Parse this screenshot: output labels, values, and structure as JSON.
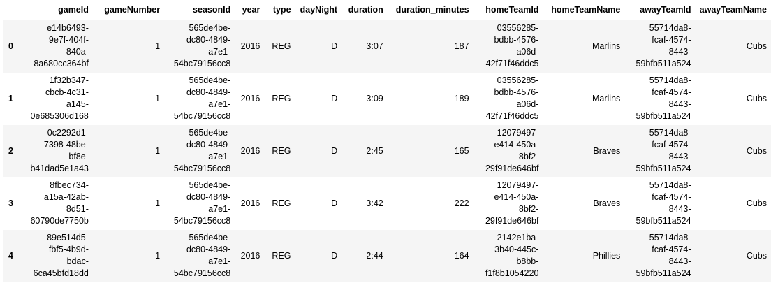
{
  "table": {
    "columns": [
      "gameId",
      "gameNumber",
      "seasonId",
      "year",
      "type",
      "dayNight",
      "duration",
      "duration_minutes",
      "homeTeamId",
      "homeTeamName",
      "awayTeamId",
      "awayTeamName"
    ],
    "rows": [
      {
        "index": "0",
        "cells": [
          [
            "e14b6493-",
            "9e7f-404f-",
            "840a-",
            "8a680cc364bf"
          ],
          [
            "1"
          ],
          [
            "565de4be-",
            "dc80-4849-",
            "a7e1-",
            "54bc79156cc8"
          ],
          [
            "2016"
          ],
          [
            "REG"
          ],
          [
            "D"
          ],
          [
            "3:07"
          ],
          [
            "187"
          ],
          [
            "03556285-",
            "bdbb-4576-",
            "a06d-",
            "42f71f46ddc5"
          ],
          [
            "Marlins"
          ],
          [
            "55714da8-",
            "fcaf-4574-",
            "8443-",
            "59bfb511a524"
          ],
          [
            "Cubs"
          ]
        ]
      },
      {
        "index": "1",
        "cells": [
          [
            "1f32b347-",
            "cbcb-4c31-",
            "a145-",
            "0e685306d168"
          ],
          [
            "1"
          ],
          [
            "565de4be-",
            "dc80-4849-",
            "a7e1-",
            "54bc79156cc8"
          ],
          [
            "2016"
          ],
          [
            "REG"
          ],
          [
            "D"
          ],
          [
            "3:09"
          ],
          [
            "189"
          ],
          [
            "03556285-",
            "bdbb-4576-",
            "a06d-",
            "42f71f46ddc5"
          ],
          [
            "Marlins"
          ],
          [
            "55714da8-",
            "fcaf-4574-",
            "8443-",
            "59bfb511a524"
          ],
          [
            "Cubs"
          ]
        ]
      },
      {
        "index": "2",
        "cells": [
          [
            "0c2292d1-",
            "7398-48be-",
            "bf8e-",
            "b41dad5e1a43"
          ],
          [
            "1"
          ],
          [
            "565de4be-",
            "dc80-4849-",
            "a7e1-",
            "54bc79156cc8"
          ],
          [
            "2016"
          ],
          [
            "REG"
          ],
          [
            "D"
          ],
          [
            "2:45"
          ],
          [
            "165"
          ],
          [
            "12079497-",
            "e414-450a-",
            "8bf2-",
            "29f91de646bf"
          ],
          [
            "Braves"
          ],
          [
            "55714da8-",
            "fcaf-4574-",
            "8443-",
            "59bfb511a524"
          ],
          [
            "Cubs"
          ]
        ]
      },
      {
        "index": "3",
        "cells": [
          [
            "8fbec734-",
            "a15a-42ab-",
            "8d51-",
            "60790de7750b"
          ],
          [
            "1"
          ],
          [
            "565de4be-",
            "dc80-4849-",
            "a7e1-",
            "54bc79156cc8"
          ],
          [
            "2016"
          ],
          [
            "REG"
          ],
          [
            "D"
          ],
          [
            "3:42"
          ],
          [
            "222"
          ],
          [
            "12079497-",
            "e414-450a-",
            "8bf2-",
            "29f91de646bf"
          ],
          [
            "Braves"
          ],
          [
            "55714da8-",
            "fcaf-4574-",
            "8443-",
            "59bfb511a524"
          ],
          [
            "Cubs"
          ]
        ]
      },
      {
        "index": "4",
        "cells": [
          [
            "89e514d5-",
            "fbf5-4b9d-",
            "bdac-",
            "6ca45bfd18dd"
          ],
          [
            "1"
          ],
          [
            "565de4be-",
            "dc80-4849-",
            "a7e1-",
            "54bc79156cc8"
          ],
          [
            "2016"
          ],
          [
            "REG"
          ],
          [
            "D"
          ],
          [
            "2:44"
          ],
          [
            "164"
          ],
          [
            "2142e1ba-",
            "3b40-445c-",
            "b8bb-",
            "f1f8b1054220"
          ],
          [
            "Phillies"
          ],
          [
            "55714da8-",
            "fcaf-4574-",
            "8443-",
            "59bfb511a524"
          ],
          [
            "Cubs"
          ]
        ]
      }
    ]
  }
}
